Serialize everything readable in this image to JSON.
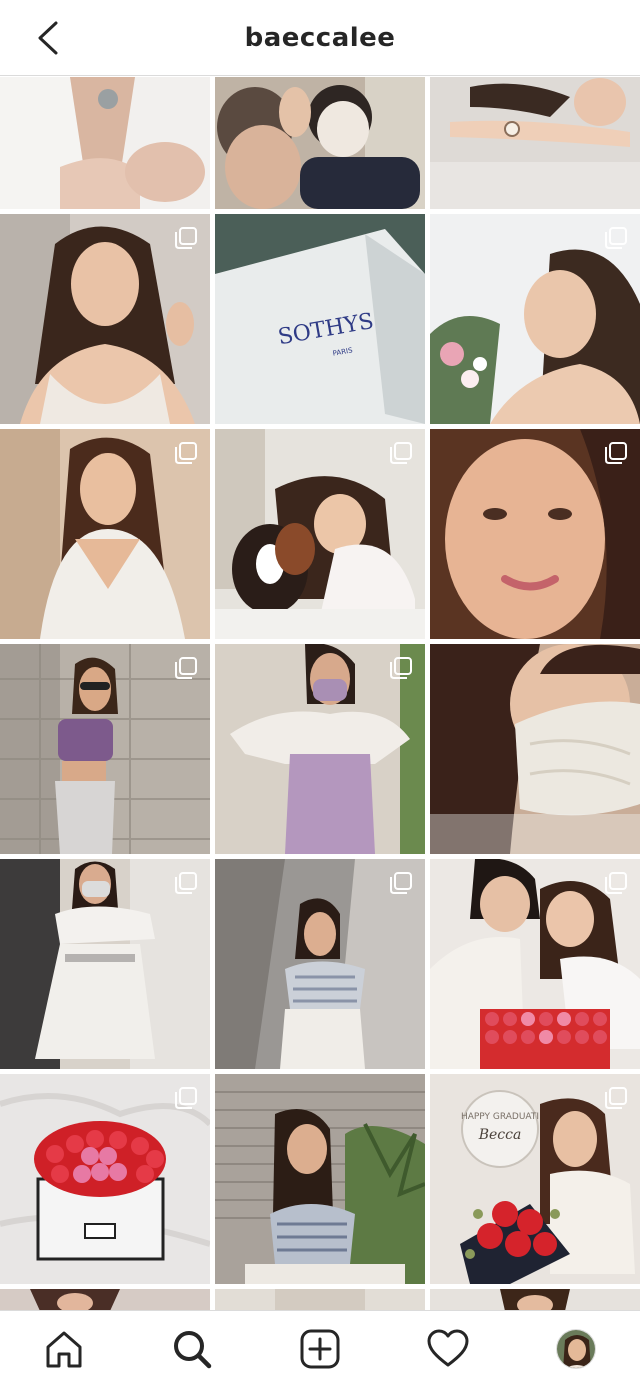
{
  "header": {
    "username": "baeccalee",
    "back_icon": "chevron-left-icon"
  },
  "grid": {
    "columns": 3,
    "posts": [
      {
        "id": "post-1",
        "desc": "white shirt necklace close-up",
        "multi": false
      },
      {
        "id": "post-2",
        "desc": "couple with face mask",
        "multi": false
      },
      {
        "id": "post-3",
        "desc": "woman lying with watch",
        "multi": false
      },
      {
        "id": "post-4",
        "desc": "woman in lace top",
        "multi": true
      },
      {
        "id": "post-5",
        "desc": "SOTHYS Paris box",
        "multi": false,
        "brand_text": "SOTHYS",
        "brand_sub": "PARIS"
      },
      {
        "id": "post-6",
        "desc": "woman with flowers outdoors",
        "multi": true
      },
      {
        "id": "post-7",
        "desc": "woman in striped top",
        "multi": true
      },
      {
        "id": "post-8",
        "desc": "woman with dog",
        "multi": true
      },
      {
        "id": "post-9",
        "desc": "close-up face portrait",
        "multi": true
      },
      {
        "id": "post-10",
        "desc": "woman in purple top by wall",
        "multi": true
      },
      {
        "id": "post-11",
        "desc": "woman in white blouse with mask",
        "multi": true
      },
      {
        "id": "post-12",
        "desc": "lace mask close-up",
        "multi": false
      },
      {
        "id": "post-13",
        "desc": "woman in white dress with mask",
        "multi": true
      },
      {
        "id": "post-14",
        "desc": "woman in striped off-shoulder top",
        "multi": true
      },
      {
        "id": "post-15",
        "desc": "couple with rose box",
        "multi": true
      },
      {
        "id": "post-16",
        "desc": "rose box with letter",
        "multi": true
      },
      {
        "id": "post-17",
        "desc": "woman by brick wall",
        "multi": false
      },
      {
        "id": "post-18",
        "desc": "woman with balloon and roses",
        "multi": true,
        "balloon_text": "HAPPY GRADUATI",
        "balloon_name": "Becca"
      }
    ]
  },
  "bottom_nav": {
    "items": [
      {
        "id": "home",
        "icon": "home-icon"
      },
      {
        "id": "search",
        "icon": "search-icon"
      },
      {
        "id": "add",
        "icon": "add-post-icon"
      },
      {
        "id": "activity",
        "icon": "heart-icon"
      },
      {
        "id": "profile",
        "icon": "profile-avatar"
      }
    ],
    "active": "search"
  }
}
